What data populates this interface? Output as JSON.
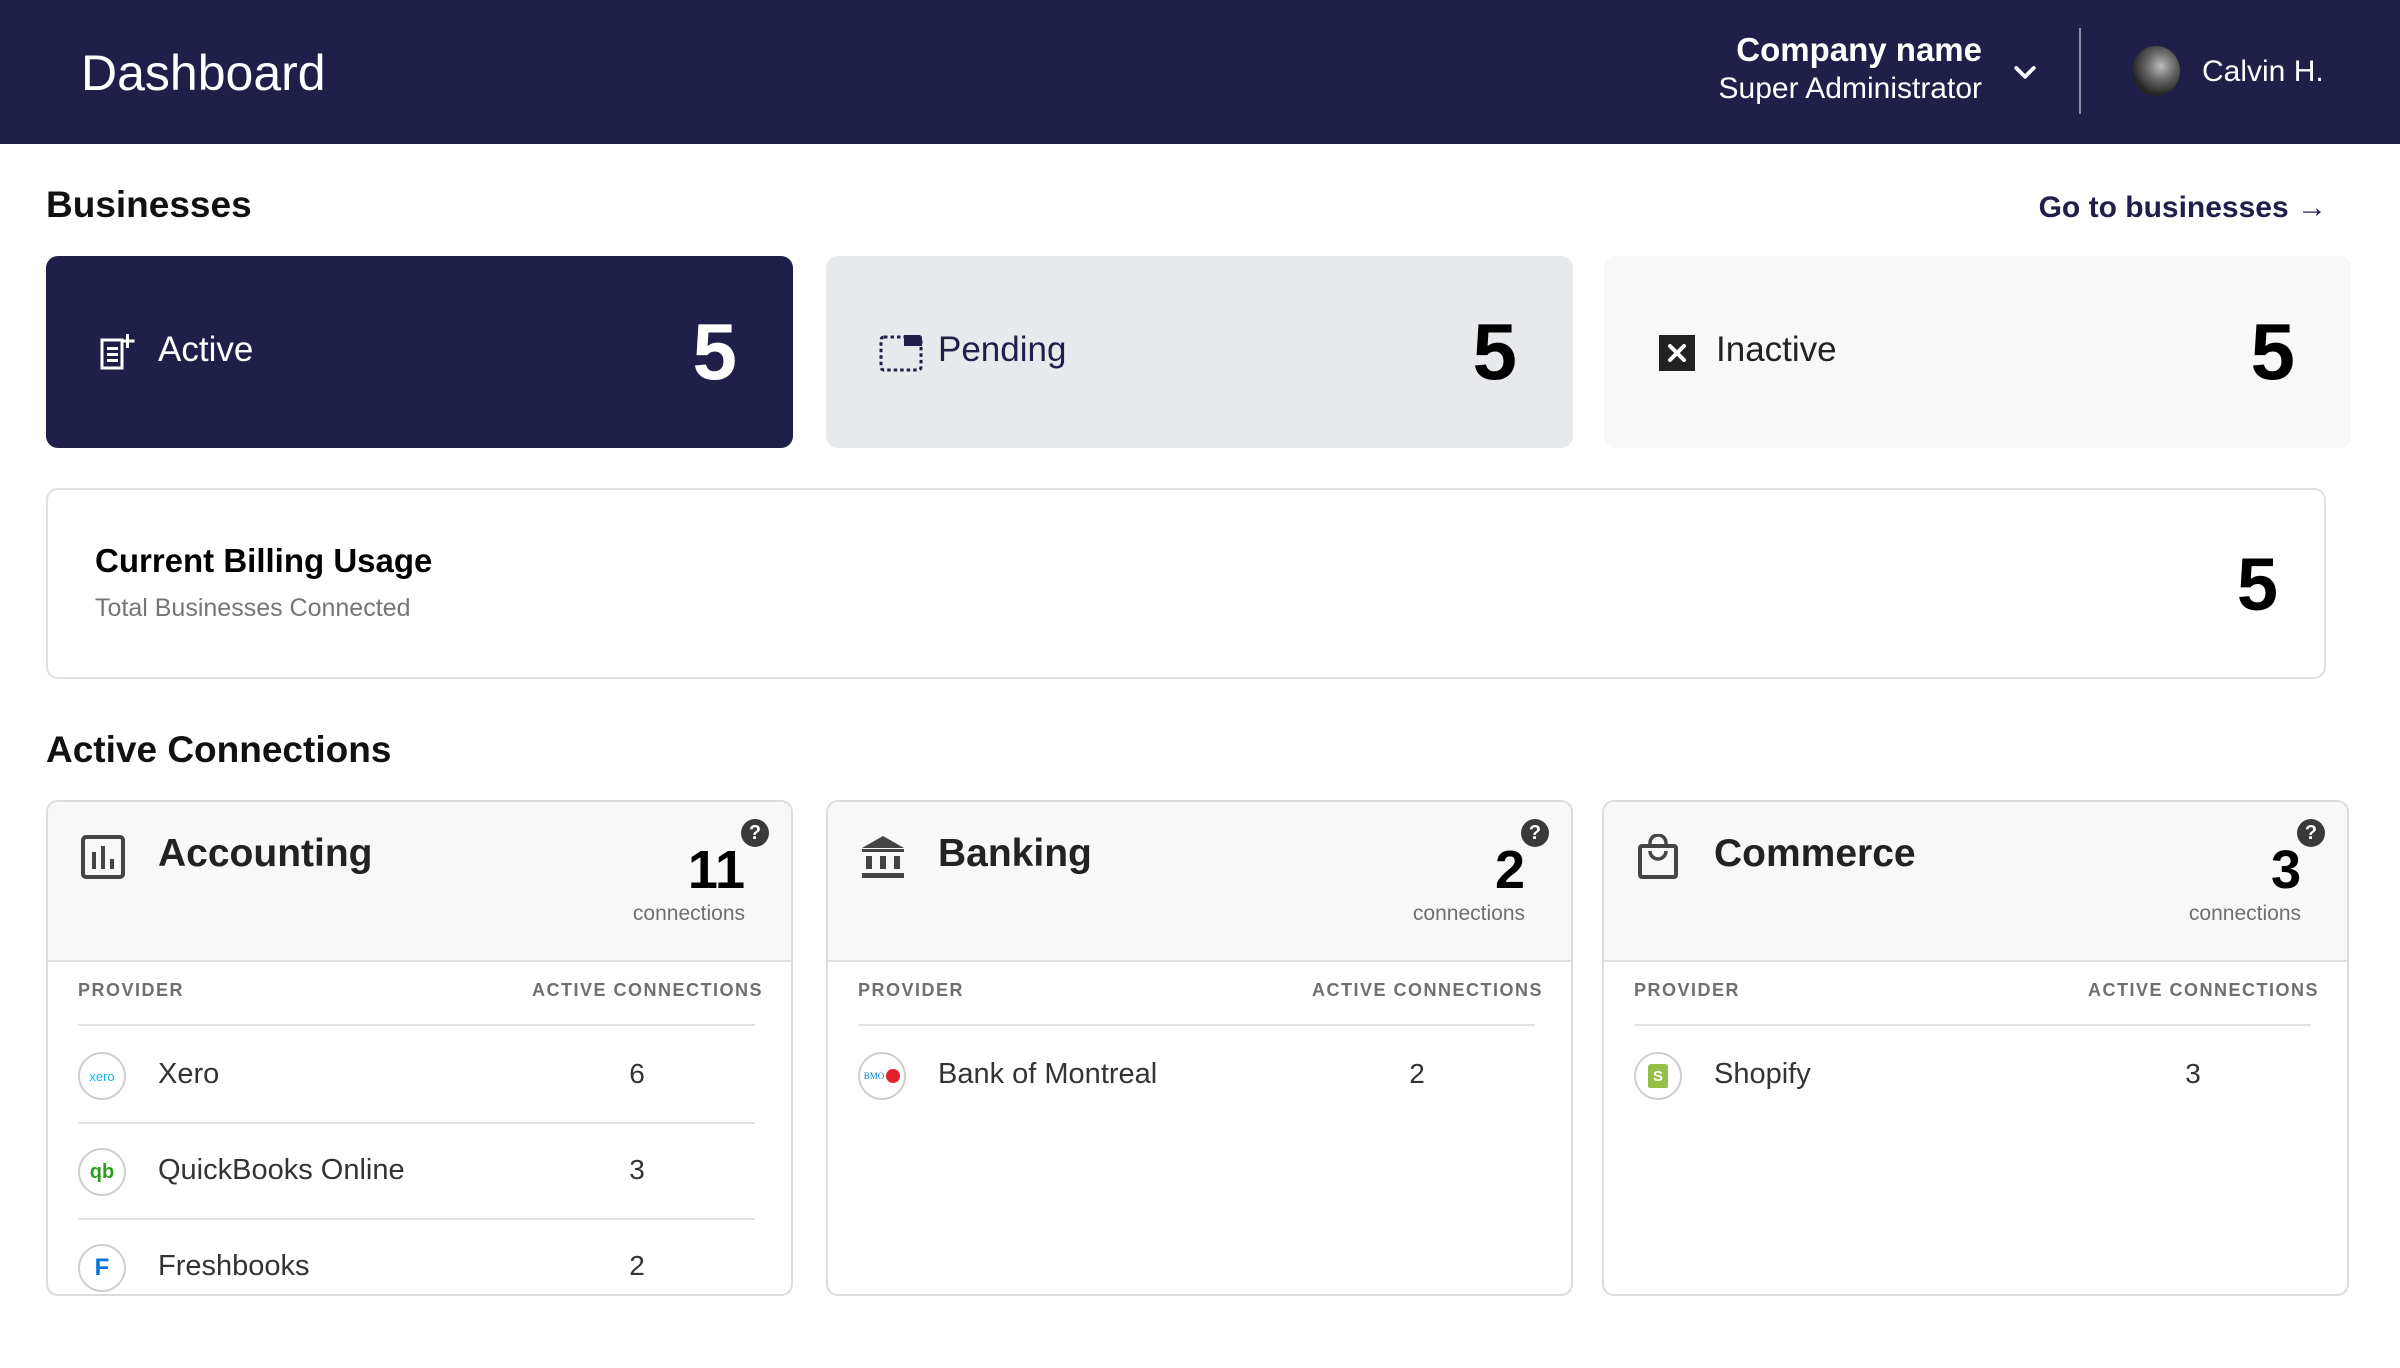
{
  "header": {
    "title": "Dashboard",
    "company_name": "Company name",
    "role": "Super Administrator",
    "user_name": "Calvin H."
  },
  "businesses": {
    "title": "Businesses",
    "go_link": "Go to businesses →",
    "cards": [
      {
        "label": "Active",
        "count": "5",
        "icon": "document-plus-icon"
      },
      {
        "label": "Pending",
        "count": "5",
        "icon": "dashed-window-icon"
      },
      {
        "label": "Inactive",
        "count": "5",
        "icon": "close-box-icon"
      }
    ]
  },
  "billing": {
    "title": "Current Billing Usage",
    "subtitle": "Total Businesses Connected",
    "count": "5"
  },
  "active_connections": {
    "title": "Active Connections",
    "help_glyph": "?",
    "column_provider": "PROVIDER",
    "column_active": "ACTIVE CONNECTIONS",
    "categories": [
      {
        "name": "Accounting",
        "icon": "bar-chart-icon",
        "count": "11",
        "unit": "connections",
        "providers": [
          {
            "name": "Xero",
            "connections": "6",
            "logo_text": "xero",
            "logo_color": "#13b5ea"
          },
          {
            "name": "QuickBooks Online",
            "connections": "3",
            "logo_text": "qb",
            "logo_color": "#2ca01c"
          },
          {
            "name": "Freshbooks",
            "connections": "2",
            "logo_text": "F",
            "logo_color": "#0075dd"
          }
        ]
      },
      {
        "name": "Banking",
        "icon": "bank-icon",
        "count": "2",
        "unit": "connections",
        "providers": [
          {
            "name": "Bank of Montreal",
            "connections": "2",
            "logo_text": "BMO",
            "logo_color": "#0079c1"
          }
        ]
      },
      {
        "name": "Commerce",
        "icon": "shopping-bag-icon",
        "count": "3",
        "unit": "connections",
        "providers": [
          {
            "name": "Shopify",
            "connections": "3",
            "logo_text": "S",
            "logo_color": "#95bf47"
          }
        ]
      }
    ]
  },
  "colors": {
    "brand_navy": "#1f1f4a",
    "pending_bg": "#e8e9ed",
    "inactive_bg": "#f8f8f8"
  }
}
